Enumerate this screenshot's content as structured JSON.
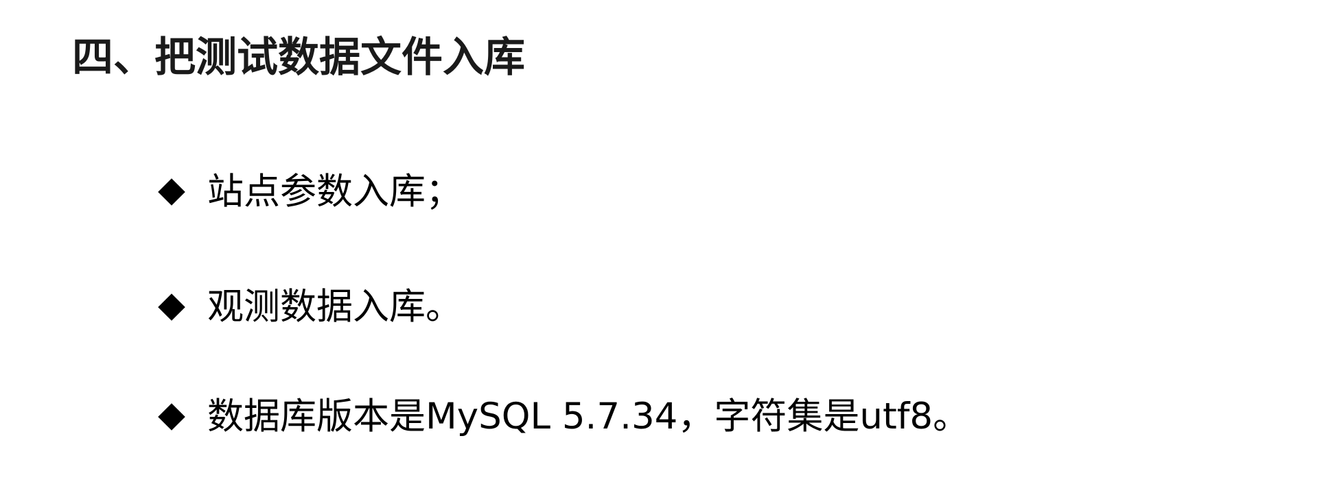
{
  "slide": {
    "title": "四、把测试数据文件入库",
    "bullets": [
      {
        "icon": "diamond-bullet-icon",
        "text": "站点参数入库；"
      },
      {
        "icon": "diamond-bullet-icon",
        "text": "观测数据入库。"
      },
      {
        "icon": "diamond-bullet-icon",
        "text": "数据库版本是MySQL 5.7.34，字符集是utf8。"
      }
    ]
  },
  "colors": {
    "background": "#ffffff",
    "title": "#1a1a1a",
    "text": "#000000",
    "bullet": "#000000"
  }
}
